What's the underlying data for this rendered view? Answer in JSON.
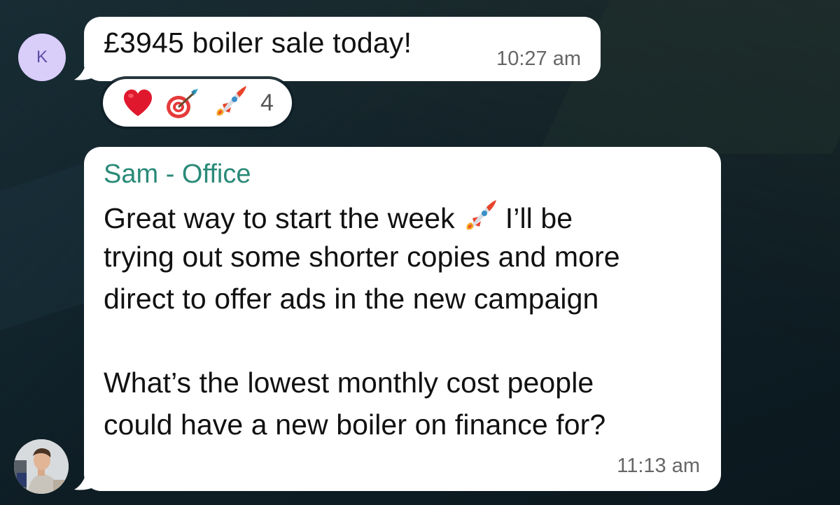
{
  "chat": {
    "messages": [
      {
        "avatar_initial": "K",
        "text": "£3945 boiler sale today!",
        "time": "10:27 am",
        "reactions": {
          "emojis": [
            "heart-icon",
            "target-icon",
            "rocket-icon"
          ],
          "count": "4"
        }
      },
      {
        "sender": "Sam - Office",
        "lines": [
          "Great way to start the week",
          "I’ll be",
          "trying out some shorter copies and more",
          "direct to offer ads in the new campaign",
          "What’s the lowest monthly cost people",
          "could have a new boiler on finance for?"
        ],
        "time": "11:13 am"
      }
    ]
  },
  "colors": {
    "sender_name": "#2a8a78",
    "avatar_k_bg": "#d9cdfa",
    "avatar_k_text": "#5b4fa8",
    "bubble_bg": "#ffffff",
    "background": "#102028"
  }
}
